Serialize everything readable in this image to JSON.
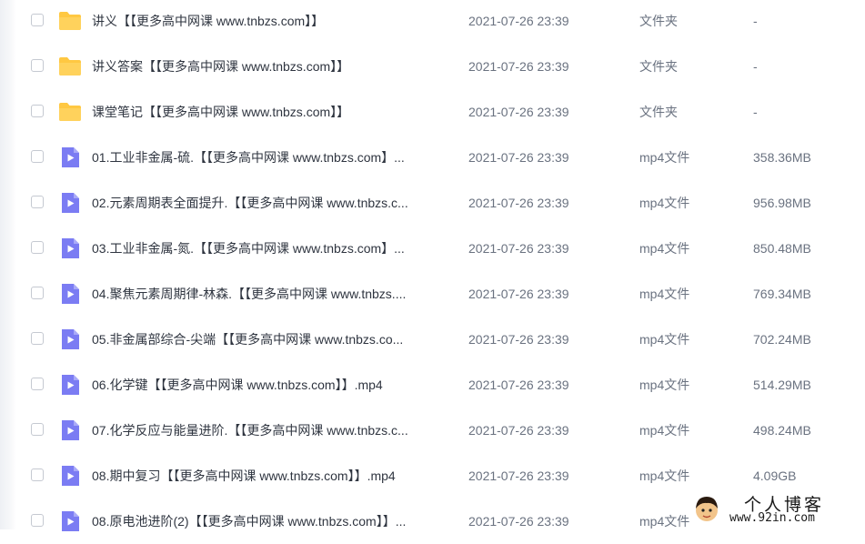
{
  "files": [
    {
      "kind": "folder",
      "name": "讲义【【更多高中网课 www.tnbzs.com】】",
      "date": "2021-07-26 23:39",
      "type": "文件夹",
      "size": "-"
    },
    {
      "kind": "folder",
      "name": "讲义答案【【更多高中网课 www.tnbzs.com】】",
      "date": "2021-07-26 23:39",
      "type": "文件夹",
      "size": "-"
    },
    {
      "kind": "folder",
      "name": "课堂笔记【【更多高中网课 www.tnbzs.com】】",
      "date": "2021-07-26 23:39",
      "type": "文件夹",
      "size": "-"
    },
    {
      "kind": "video",
      "name": "01.工业非金属-硫.【【更多高中网课 www.tnbzs.com】...",
      "date": "2021-07-26 23:39",
      "type": "mp4文件",
      "size": "358.36MB"
    },
    {
      "kind": "video",
      "name": "02.元素周期表全面提升.【【更多高中网课 www.tnbzs.c...",
      "date": "2021-07-26 23:39",
      "type": "mp4文件",
      "size": "956.98MB"
    },
    {
      "kind": "video",
      "name": "03.工业非金属-氮.【【更多高中网课 www.tnbzs.com】...",
      "date": "2021-07-26 23:39",
      "type": "mp4文件",
      "size": "850.48MB"
    },
    {
      "kind": "video",
      "name": "04.聚焦元素周期律-林森.【【更多高中网课 www.tnbzs....",
      "date": "2021-07-26 23:39",
      "type": "mp4文件",
      "size": "769.34MB"
    },
    {
      "kind": "video",
      "name": "05.非金属部综合-尖端【【更多高中网课 www.tnbzs.co...",
      "date": "2021-07-26 23:39",
      "type": "mp4文件",
      "size": "702.24MB"
    },
    {
      "kind": "video",
      "name": "06.化学键【【更多高中网课 www.tnbzs.com】】.mp4",
      "date": "2021-07-26 23:39",
      "type": "mp4文件",
      "size": "514.29MB"
    },
    {
      "kind": "video",
      "name": "07.化学反应与能量进阶.【【更多高中网课 www.tnbzs.c...",
      "date": "2021-07-26 23:39",
      "type": "mp4文件",
      "size": "498.24MB"
    },
    {
      "kind": "video",
      "name": "08.期中复习【【更多高中网课 www.tnbzs.com】】.mp4",
      "date": "2021-07-26 23:39",
      "type": "mp4文件",
      "size": "4.09GB"
    },
    {
      "kind": "video",
      "name": "08.原电池进阶(2)【【更多高中网课 www.tnbzs.com】】...",
      "date": "2021-07-26 23:39",
      "type": "mp4文件",
      "size": ""
    }
  ],
  "icons": {
    "folder": "folder-icon",
    "video": "video-file-icon",
    "folder_color": "#ffc842",
    "video_color": "#7b7cf3"
  },
  "watermark": {
    "title": "个人博客",
    "url": "www.92in.com"
  }
}
